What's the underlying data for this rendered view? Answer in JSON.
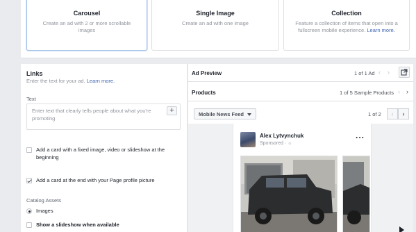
{
  "formats": [
    {
      "title": "Carousel",
      "desc": "Create an ad with 2 or more scrollable images",
      "link": ""
    },
    {
      "title": "Single Image",
      "desc": "Create an ad with one image",
      "link": ""
    },
    {
      "title": "Collection",
      "desc": "Feature a collection of items that open into a fullscreen mobile experience.",
      "link": "Learn more."
    }
  ],
  "links": {
    "title": "Links",
    "subtitle": "Enter the text for your ad.",
    "learn_more": "Learn more.",
    "text_label": "Text",
    "text_placeholder": "Enter text that clearly tells people about what you're promoting",
    "text_value": "",
    "add_button": "+",
    "option_fixed_card": "Add a card with a fixed image, video or slideshow at the beginning",
    "option_end_card": "Add a card at the end with your Page profile picture",
    "catalog_label": "Catalog Assets",
    "radio_images": "Images",
    "radio_slideshow": "Show a slideshow when available"
  },
  "preview": {
    "title": "Ad Preview",
    "ad_count": "1 of 1 Ad",
    "products_label": "Products",
    "products_count": "1 of 5 Sample Products",
    "placement": "Mobile News Feed",
    "page_count": "1 of 2",
    "poster_name": "Alex Lytvynchuk",
    "sponsored": "Sponsored",
    "more": "..."
  },
  "colors": {
    "accent": "#4267b2",
    "panel_bg": "#ffffff",
    "page_bg": "#e9ebee"
  }
}
